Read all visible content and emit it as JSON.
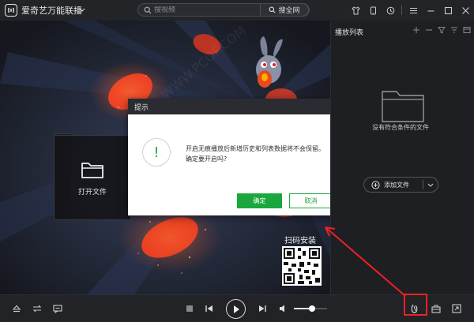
{
  "app": {
    "title": "爱奇艺万能联播",
    "logo_icon": "iqiyi-logo-icon"
  },
  "search": {
    "placeholder": "搜视频",
    "button_label": "搜全网"
  },
  "titlebar_icons": [
    "tshirt-skin-icon",
    "phone-icon",
    "clock-icon",
    "menu-icon",
    "minimize-icon",
    "maximize-icon",
    "close-icon"
  ],
  "dialog": {
    "title": "提示",
    "icon": "exclamation-icon",
    "icon_glyph": "!",
    "message_line1": "开启无痕播放后新增历史和列表数据将不会保留。",
    "message_line2": "确定要开启吗?",
    "ok_label": "确定",
    "cancel_label": "取消"
  },
  "stage": {
    "open_file_label": "打开文件",
    "scan_install_label": "扫码安装"
  },
  "playlist": {
    "title": "播放列表",
    "empty_message": "没有符合条件的文件",
    "add_file_label": "添加文件",
    "tool_icons": [
      "plus-icon",
      "minus-icon",
      "filter-icon",
      "sort-icon",
      "layout-icon"
    ]
  },
  "controls": {
    "volume_fraction": 0.55,
    "left_icons": [
      "eject-icon",
      "loop-icon",
      "subtitle-icon"
    ],
    "right_icons": [
      "incognito-traceless-icon",
      "toolbox-icon",
      "fullscreen-icon"
    ]
  },
  "colors": {
    "accent_green": "#1aa73e",
    "highlight_red": "#e22222"
  }
}
